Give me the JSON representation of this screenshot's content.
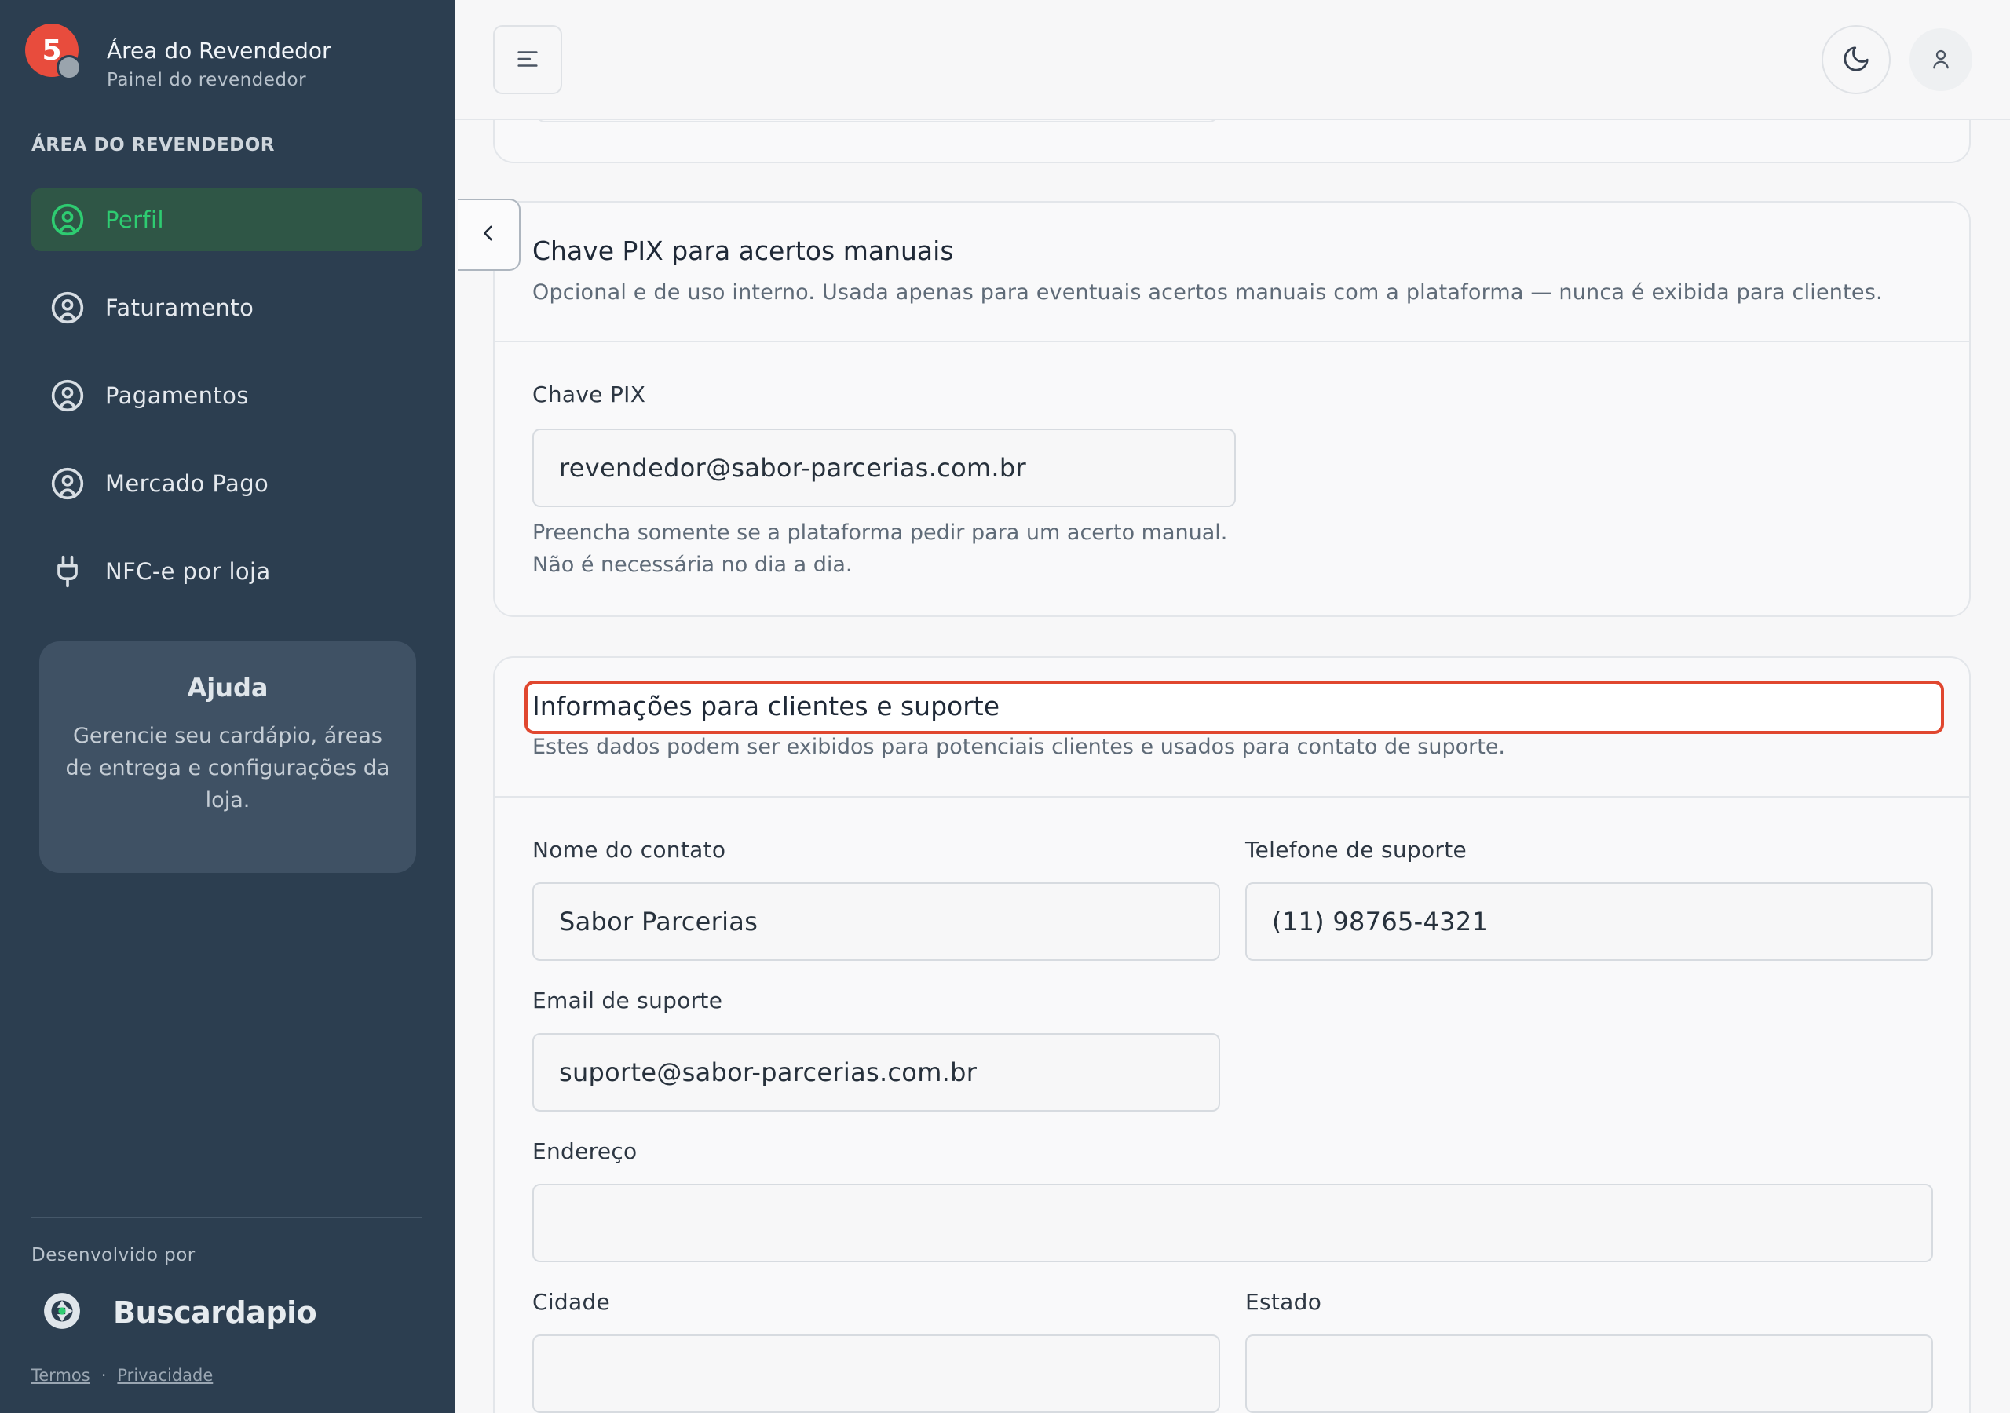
{
  "brand": {
    "badge": "5",
    "title": "Área do Revendedor",
    "subtitle": "Painel do revendedor"
  },
  "sidebar": {
    "section_label": "ÁREA DO REVENDEDOR",
    "items": [
      {
        "label": "Perfil",
        "icon": "user-circle-icon",
        "active": true
      },
      {
        "label": "Faturamento",
        "icon": "user-circle-icon"
      },
      {
        "label": "Pagamentos",
        "icon": "user-circle-icon"
      },
      {
        "label": "Mercado Pago",
        "icon": "user-circle-icon"
      },
      {
        "label": "NFC-e por loja",
        "icon": "plug-icon"
      }
    ],
    "help": {
      "title": "Ajuda",
      "text": "Gerencie seu cardápio, áreas de entrega e configurações da loja."
    },
    "footer": {
      "developed_by": "Desenvolvido por",
      "logo_name": "Buscardapio",
      "terms": "Termos",
      "separator": "·",
      "privacy": "Privacidade"
    }
  },
  "pix": {
    "title": "Chave PIX para acertos manuais",
    "description": "Opcional e de uso interno. Usada apenas para eventuais acertos manuais com a plataforma — nunca é exibida para clientes.",
    "field_label": "Chave PIX",
    "field_value": "revendedor@sabor-parcerias.com.br",
    "hint_line1": "Preencha somente se a plataforma pedir para um acerto manual.",
    "hint_line2": "Não é necessária no dia a dia."
  },
  "support": {
    "title": "Informações para clientes e suporte",
    "description": "Estes dados podem ser exibidos para potenciais clientes e usados para contato de suporte.",
    "contact_name_label": "Nome do contato",
    "contact_name_value": "Sabor Parcerias",
    "phone_label": "Telefone de suporte",
    "phone_value": "(11) 98765-4321",
    "email_label": "Email de suporte",
    "email_value": "suporte@sabor-parcerias.com.br",
    "address_label": "Endereço",
    "address_value": "",
    "city_label": "Cidade",
    "city_value": "",
    "state_label": "Estado",
    "state_value": ""
  },
  "colors": {
    "sidebar_bg": "#2c3e50",
    "active_green": "#2ecc71",
    "badge_red": "#e84c3d",
    "highlight_red": "#e0472f"
  }
}
